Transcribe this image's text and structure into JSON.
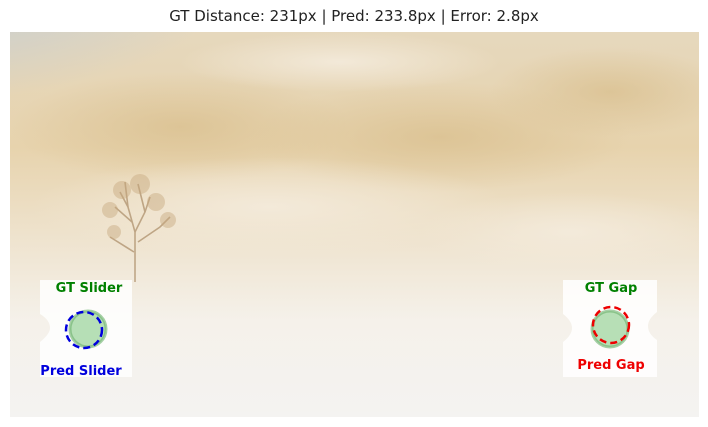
{
  "title": "GT Distance: 231px | Pred: 233.8px | Error: 2.8px",
  "labels": {
    "gt_slider": "GT Slider",
    "pred_slider": "Pred Slider",
    "gt_gap": "GT Gap",
    "pred_gap": "Pred Gap"
  },
  "colors": {
    "gt": "#008000",
    "pred_slider": "#0000dd",
    "pred_gap": "#ee0000",
    "gt_marker_fill": "#90d090"
  }
}
